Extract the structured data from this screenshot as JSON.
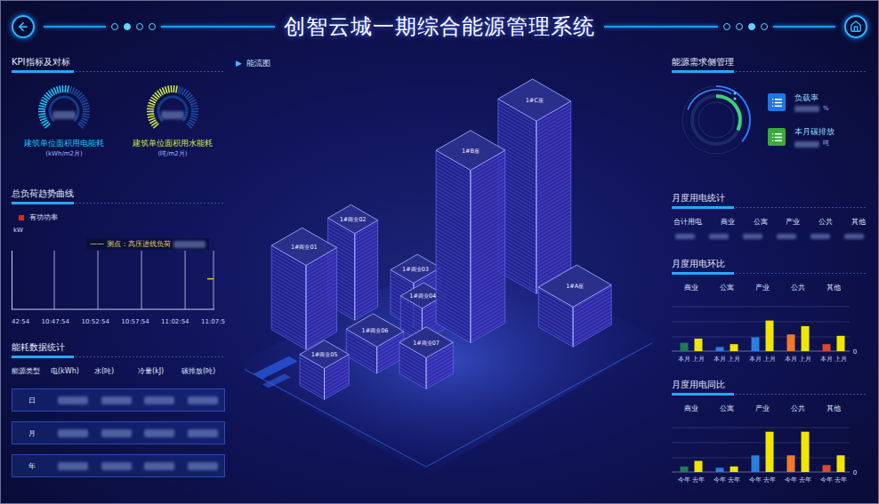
{
  "header": {
    "title": "创智云城一期综合能源管理系统",
    "pager_left": [
      {
        "selected": false
      },
      {
        "selected": true
      },
      {
        "selected": false
      },
      {
        "selected": false
      }
    ],
    "pager_right": [
      {
        "selected": false
      },
      {
        "selected": false
      },
      {
        "selected": true
      },
      {
        "selected": false
      }
    ]
  },
  "kpi": {
    "title": "KPI指标及对标",
    "gauges": [
      {
        "label": "建筑单位面积用电能耗",
        "unit": "(kWh/m2月)",
        "level": 0.55,
        "color": "#1ec8ff"
      },
      {
        "label": "建筑单位面积用水能耗",
        "unit": "(吨/m2月)",
        "level": 0.55,
        "color": "#d4e84a"
      }
    ]
  },
  "load": {
    "title": "总负荷趋势曲线",
    "legend": {
      "label": "有功功率",
      "color": "#d42a2a"
    },
    "unit": "kW",
    "tooltip": "—— 测点：高压进线负荷",
    "times": [
      "42:54",
      "10:47:54",
      "10:52:54",
      "10:57:54",
      "11:02:54",
      "11:07:5"
    ],
    "series": {
      "color": "#e8c020",
      "values": [
        52,
        52
      ]
    }
  },
  "energy": {
    "title": "能耗数据统计",
    "columns": [
      "能源类型",
      "电(kWh)",
      "水(吨)",
      "冷量(kJ)",
      "碳排放(吨)"
    ],
    "rows": [
      "日",
      "月",
      "年"
    ]
  },
  "flow": {
    "marker": "▶",
    "title": "能流图",
    "buildings": [
      "1#C座",
      "1#B座",
      "1#商业01",
      "1#商业02",
      "1#商业03",
      "1#商业04",
      "1#A座",
      "1#商业05",
      "1#商业06",
      "1#商业07"
    ]
  },
  "demand": {
    "title": "能源需求侧管理",
    "ring_level": 0.32,
    "stats": [
      {
        "label": "负载率",
        "unit": "%",
        "color": "#1f78e0"
      },
      {
        "label": "本月碳排放",
        "unit": "吨",
        "color": "#3caa3c"
      }
    ]
  },
  "monthly": {
    "title": "月度用电统计",
    "columns": [
      "合计用电",
      "商业",
      "公寓",
      "产业",
      "公共",
      "其他"
    ]
  },
  "mom": {
    "title": "月度用电环比",
    "periods": [
      "本月",
      "上月"
    ],
    "axis_zero": "0",
    "categories": [
      {
        "name": "商业",
        "color": "#1f7a55",
        "values": [
          6,
          9
        ]
      },
      {
        "name": "公寓",
        "color": "#2a7fe0",
        "values": [
          3,
          5
        ]
      },
      {
        "name": "产业",
        "color": "#2a7fe0",
        "values": [
          10,
          22
        ]
      },
      {
        "name": "公共",
        "color": "#f07a2a",
        "values": [
          12,
          18
        ]
      },
      {
        "name": "其他",
        "color": "#e0482a",
        "values": [
          5,
          11
        ]
      }
    ]
  },
  "yoy": {
    "title": "月度用电同比",
    "periods": [
      "今年",
      "去年"
    ],
    "axis_zero": "0",
    "categories": [
      {
        "name": "商业",
        "color": "#1f7a55",
        "values": [
          4,
          8
        ]
      },
      {
        "name": "公寓",
        "color": "#2a7fe0",
        "values": [
          3,
          4
        ]
      },
      {
        "name": "产业",
        "color": "#2a7fe0",
        "values": [
          12,
          29
        ]
      },
      {
        "name": "公共",
        "color": "#f07a2a",
        "values": [
          12,
          29
        ]
      },
      {
        "name": "其他",
        "color": "#e0482a",
        "values": [
          5,
          12
        ]
      }
    ]
  }
}
